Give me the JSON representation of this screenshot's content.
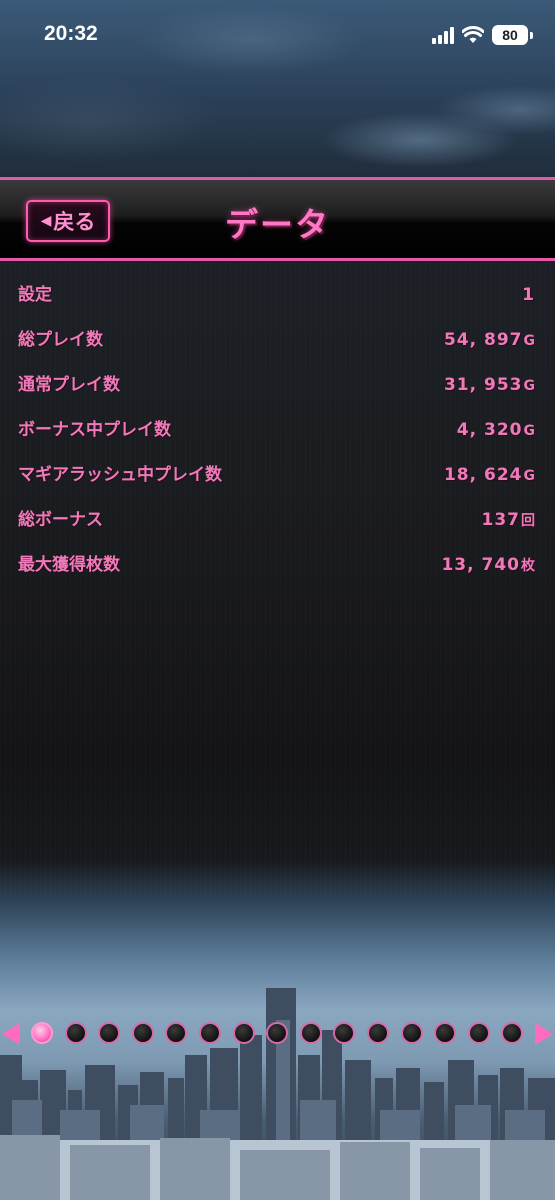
{
  "status_bar": {
    "time": "20:32",
    "battery": "80"
  },
  "header": {
    "back_label": "戻る",
    "title": "データ"
  },
  "data_rows": [
    {
      "label": "設定",
      "value": "1",
      "unit": ""
    },
    {
      "label": "総プレイ数",
      "value": "54, 897",
      "unit": "G"
    },
    {
      "label": "通常プレイ数",
      "value": "31, 953",
      "unit": "G"
    },
    {
      "label": "ボーナス中プレイ数",
      "value": "4, 320",
      "unit": "G"
    },
    {
      "label": "マギアラッシュ中プレイ数",
      "value": "18, 624",
      "unit": "G"
    },
    {
      "label": "総ボーナス",
      "value": "137",
      "unit": "回"
    },
    {
      "label": "最大獲得枚数",
      "value": "13, 740",
      "unit": "枚"
    }
  ],
  "pagination": {
    "total_pages": 15,
    "current_page": 1
  },
  "colors": {
    "accent_pink": "#ff6cbe",
    "text_pink": "#f07ab9",
    "header_border": "#e45aa8"
  }
}
